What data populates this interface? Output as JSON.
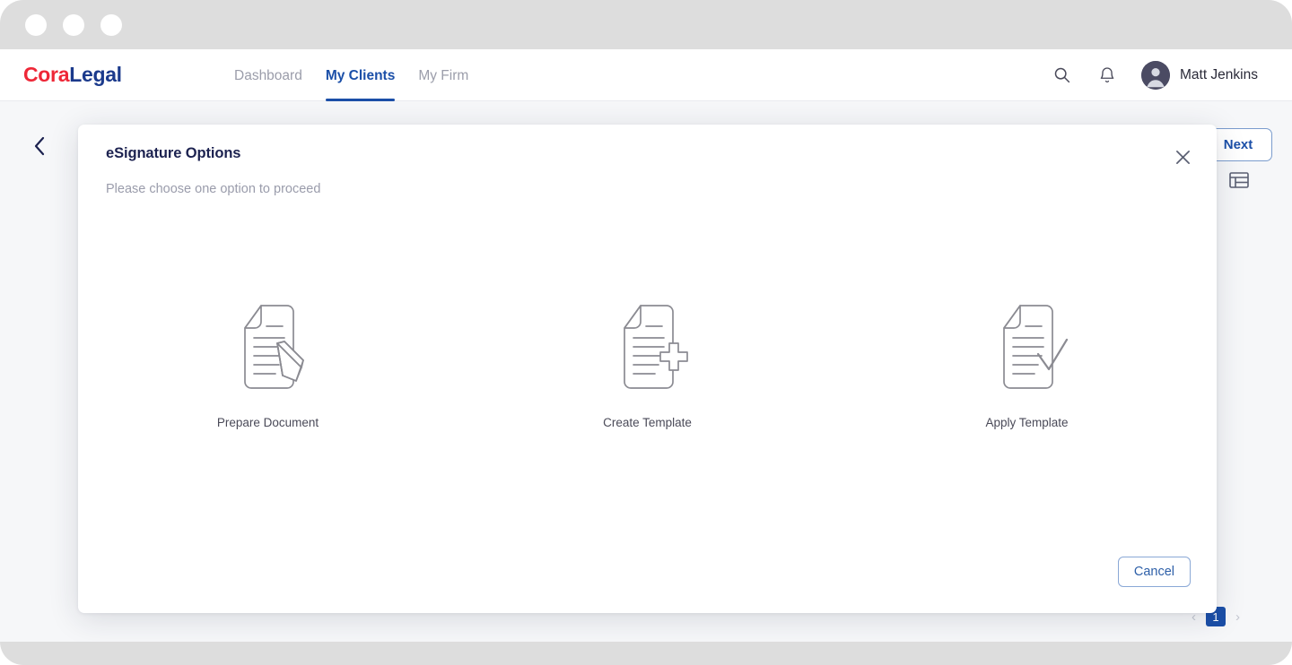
{
  "window": {
    "dots": [
      "dot-1",
      "dot-2",
      "dot-3"
    ]
  },
  "header": {
    "logo_primary": "Cora",
    "logo_secondary": "Legal",
    "nav": [
      {
        "label": "Dashboard",
        "active": false
      },
      {
        "label": "My Clients",
        "active": true
      },
      {
        "label": "My Firm",
        "active": false
      }
    ],
    "search_icon": "search-icon",
    "notification_icon": "bell-icon",
    "avatar_icon": "user-avatar-icon",
    "user_name": "Matt Jenkins"
  },
  "page": {
    "back_icon": "chevron-left-icon",
    "next_button_label": "Next",
    "list_view_icon": "list-view-icon",
    "pagination": {
      "prev_icon": "chevron-left-icon",
      "current_page": "1",
      "next_icon": "chevron-right-icon"
    }
  },
  "modal": {
    "title": "eSignature Options",
    "subtitle": "Please choose one option to proceed",
    "close_icon": "close-icon",
    "options": [
      {
        "label": "Prepare Document",
        "icon": "document-pencil-icon"
      },
      {
        "label": "Create Template",
        "icon": "document-plus-icon"
      },
      {
        "label": "Apply Template",
        "icon": "document-check-icon"
      }
    ],
    "cancel_label": "Cancel"
  },
  "colors": {
    "brand_red": "#ee2737",
    "brand_navy": "#1b3a8c",
    "accent_blue": "#1b4fa8",
    "page_bg": "#f6f7f9",
    "muted_text": "#9a9cab"
  }
}
